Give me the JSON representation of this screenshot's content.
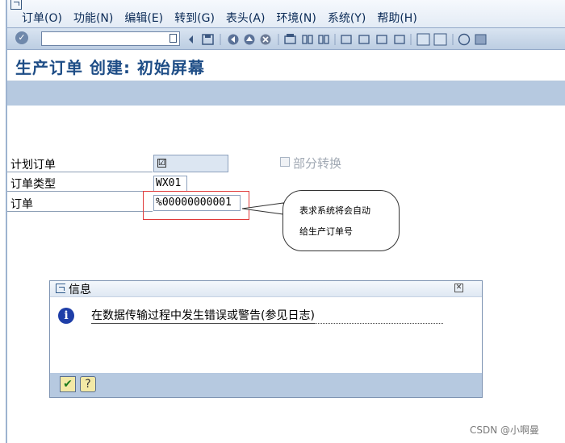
{
  "menu": {
    "items": [
      {
        "label": "订单(O)"
      },
      {
        "label": "功能(N)"
      },
      {
        "label": "编辑(E)"
      },
      {
        "label": "转到(G)"
      },
      {
        "label": "表头(A)"
      },
      {
        "label": "环境(N)"
      },
      {
        "label": "系统(Y)"
      },
      {
        "label": "帮助(H)"
      }
    ]
  },
  "toolbar": {
    "command_value": "",
    "ok_symbol": "✓"
  },
  "page": {
    "title": "生产订单 创建: 初始屏幕"
  },
  "form": {
    "planned_order_label": "计划订单",
    "planned_order_checked": "☑",
    "order_type_label": "订单类型",
    "order_type_value": "WX01",
    "order_label": "订单",
    "order_value": "%00000000001",
    "partial_convert_label": "部分转换"
  },
  "callout": {
    "line1": "表求系统将会自动",
    "line2": "给生产订单号"
  },
  "dialog": {
    "title": "信息",
    "close_symbol": "✕",
    "info_symbol": "i",
    "message": "在数据传输过程中发生错误或警告(参见日志)",
    "confirm_symbol": "✔",
    "help_symbol": "?"
  },
  "watermark": "CSDN @小啊曼",
  "colors": {
    "accent": "#1e4d86",
    "appbar": "#b6c9e0",
    "highlight": "#e03a3a"
  }
}
